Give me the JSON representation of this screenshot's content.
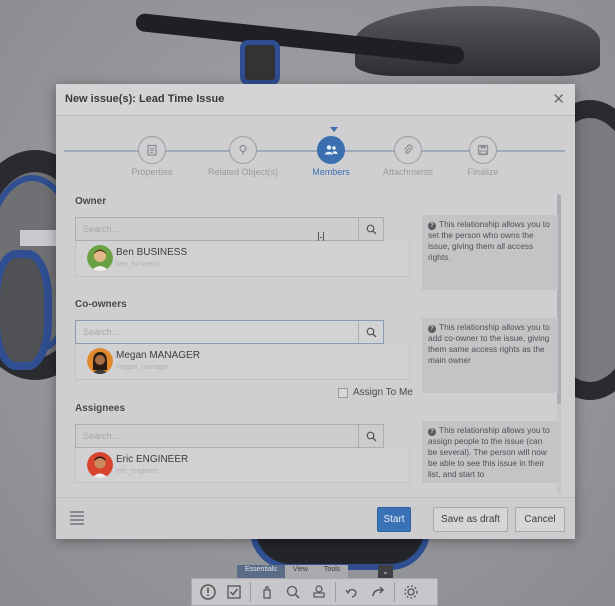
{
  "dialog": {
    "title": "New issue(s): Lead Time Issue",
    "close_label": "✕"
  },
  "steps": [
    {
      "label": "Properties",
      "icon": "clipboard-icon",
      "active": false
    },
    {
      "label": "Related Object(s)",
      "icon": "pin-icon",
      "active": false
    },
    {
      "label": "Members",
      "icon": "people-icon",
      "active": true
    },
    {
      "label": "Attachments",
      "icon": "paperclip-icon",
      "active": false
    },
    {
      "label": "Finalize",
      "icon": "save-icon",
      "active": false
    }
  ],
  "owner": {
    "title": "Owner",
    "search_placeholder": "Search...",
    "person_name": "Ben BUSINESS",
    "person_sub": "ben_business",
    "help": "This relationship allows you to set the person who owns the issue, giving them all access rights."
  },
  "coowners": {
    "title": "Co-owners",
    "search_placeholder": "Search...",
    "person_name": "Megan MANAGER",
    "person_sub": "megan_manager",
    "help": "This relationship allows you to add co-owner to the issue, giving them same access rights as the main owner"
  },
  "assignees": {
    "title": "Assignees",
    "assign_to_me": "Assign To Me",
    "search_placeholder": "Search...",
    "person_name": "Eric ENGINEER",
    "person_sub": "eric_engineer",
    "help": "This relationship allows you to assign people to the issue (can be several). The person will now be able to see this issue in their list, and start to"
  },
  "footer": {
    "start": "Start",
    "save_draft": "Save as draft",
    "cancel": "Cancel"
  },
  "toolbar": {
    "tabs": [
      "Essentials",
      "View",
      "Tools"
    ],
    "active_tab": "Essentials",
    "expand_label": "⌄"
  },
  "colors": {
    "accent": "#3a73b5",
    "bike_blue": "#2f4f92"
  }
}
